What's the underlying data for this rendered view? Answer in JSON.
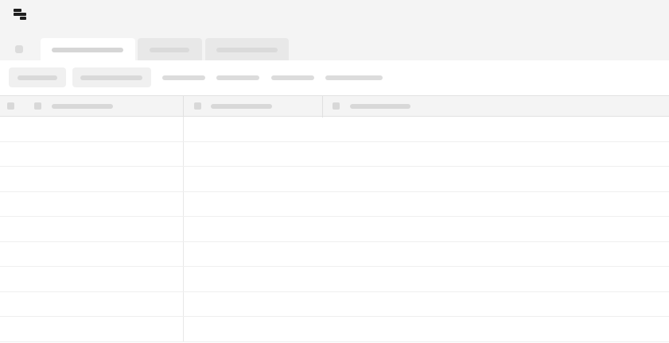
{
  "app": {
    "logo_icon": "stacked-bars-logo-icon"
  },
  "tabs": [
    {
      "label": "",
      "state": "active"
    },
    {
      "label": "",
      "state": "inactive"
    },
    {
      "label": "",
      "state": "inactive"
    }
  ],
  "toolbar": {
    "buttons": [
      {
        "label": ""
      },
      {
        "label": ""
      }
    ],
    "links": [
      {
        "label": ""
      },
      {
        "label": ""
      },
      {
        "label": ""
      },
      {
        "label": ""
      }
    ]
  },
  "grid": {
    "columns": [
      {
        "label": ""
      },
      {
        "label": ""
      },
      {
        "label": ""
      }
    ],
    "rows": [
      [
        "",
        "",
        ""
      ],
      [
        "",
        "",
        ""
      ],
      [
        "",
        "",
        ""
      ],
      [
        "",
        "",
        ""
      ],
      [
        "",
        "",
        ""
      ],
      [
        "",
        "",
        ""
      ],
      [
        "",
        "",
        ""
      ],
      [
        "",
        "",
        ""
      ],
      [
        "",
        "",
        ""
      ]
    ]
  },
  "colors": {
    "topbar_bg": "#f4f4f4",
    "placeholder": "#d8d8d8",
    "logo": "#1e1e1e"
  }
}
